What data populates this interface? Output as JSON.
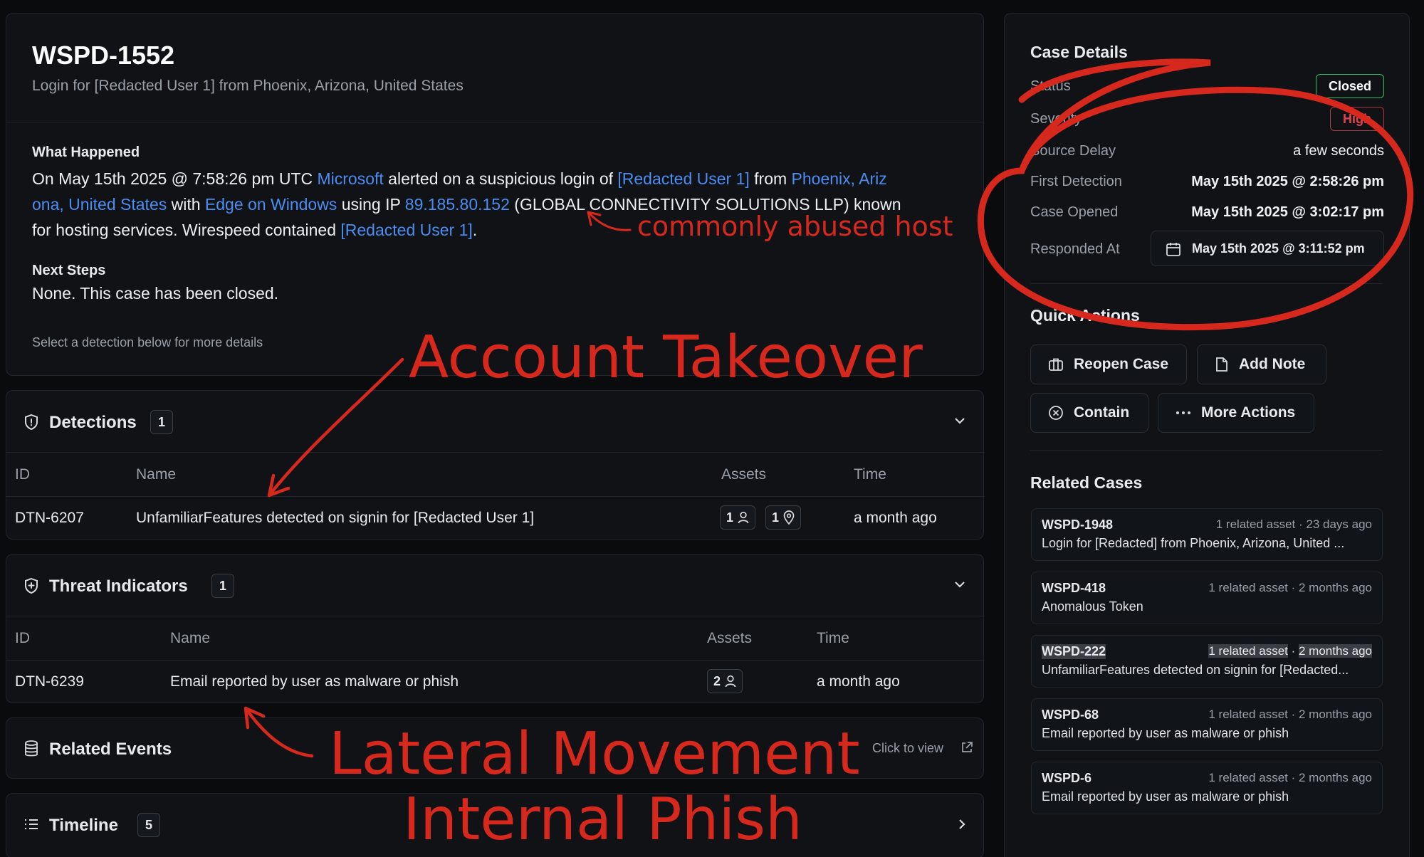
{
  "case": {
    "id": "WSPD-1552",
    "subtitle": "Login for [Redacted User 1] from Phoenix, Arizona, United States",
    "what_happened_title": "What Happened",
    "wh1a": "On May 15th 2025 @ 7:58:26 pm UTC ",
    "wh1b": "Microsoft",
    "wh1c": " alerted on a suspicious login of ",
    "wh1d": "[Redacted User 1]",
    "wh1e": " from ",
    "wh1f": "Phoenix, Ariz",
    "wh2a": "ona, United States",
    "wh2b": " with ",
    "wh2c": "Edge on Windows",
    "wh2d": " using IP ",
    "wh2e": "89.185.80.152",
    "wh2f": " (GLOBAL CONNECTIVITY SOLUTIONS LLP) known",
    "wh3a": "for hosting services. Wirespeed contained ",
    "wh3b": "[Redacted User 1]",
    "wh3c": ".",
    "next_steps_title": "Next Steps",
    "next_steps": "None. This case has been closed.",
    "hint": "Select a detection below for more details"
  },
  "detections": {
    "title": "Detections",
    "count": "1",
    "headers": {
      "id": "ID",
      "name": "Name",
      "assets": "Assets",
      "time": "Time"
    },
    "rows": [
      {
        "id": "DTN-6207",
        "name": "UnfamiliarFeatures detected on signin for [Redacted User 1]",
        "users": "1",
        "locations": "1",
        "time": "a month ago"
      }
    ]
  },
  "threats": {
    "title": "Threat Indicators",
    "count": "1",
    "headers": {
      "id": "ID",
      "name": "Name",
      "assets": "Assets",
      "time": "Time"
    },
    "rows": [
      {
        "id": "DTN-6239",
        "name": "Email reported by user as malware or phish",
        "users": "2",
        "time": "a month ago"
      }
    ]
  },
  "related_events": {
    "title": "Related Events",
    "link": "Click to view"
  },
  "timeline": {
    "title": "Timeline",
    "count": "5"
  },
  "case_details": {
    "title": "Case Details",
    "status_label": "Status",
    "status": "Closed",
    "severity_label": "Severity",
    "severity": "High",
    "source_delay_label": "Source Delay",
    "source_delay": "a few seconds",
    "first_detection_label": "First Detection",
    "first_detection": "May 15th 2025 @ 2:58:26 pm",
    "case_opened_label": "Case Opened",
    "case_opened": "May 15th 2025 @ 3:02:17 pm",
    "responded_label": "Responded At",
    "responded": "May 15th 2025 @ 3:11:52 pm"
  },
  "quick_actions": {
    "title": "Quick Actions",
    "reopen": "Reopen Case",
    "add_note": "Add Note",
    "contain": "Contain",
    "more": "More Actions"
  },
  "related_cases": {
    "title": "Related Cases",
    "items": [
      {
        "id": "WSPD-1948",
        "meta": "1 related asset · 23 days ago",
        "desc": "Login for [Redacted] from Phoenix, Arizona, United ..."
      },
      {
        "id": "WSPD-418",
        "meta": "1 related asset · 2 months ago",
        "desc": "Anomalous Token"
      },
      {
        "id": "WSPD-222",
        "meta_a": "1 related asset",
        "meta_sep": " · ",
        "meta_b": "2 months ago",
        "desc": "UnfamiliarFeatures detected on signin for [Redacted..."
      },
      {
        "id": "WSPD-68",
        "meta": "1 related asset · 2 months ago",
        "desc": "Email reported by user as malware or phish"
      },
      {
        "id": "WSPD-6",
        "meta": "1 related asset · 2 months ago",
        "desc": "Email reported by user as malware or phish"
      }
    ]
  },
  "annotations": {
    "host": "commonly abused host",
    "ato": "Account Takeover",
    "lateral": "Lateral Movement",
    "phish": "Internal Phish"
  },
  "colors": {
    "annotation": "#d7281d",
    "link": "#4b8df0",
    "closed": "#2fbf6a",
    "high": "#e0454f"
  }
}
